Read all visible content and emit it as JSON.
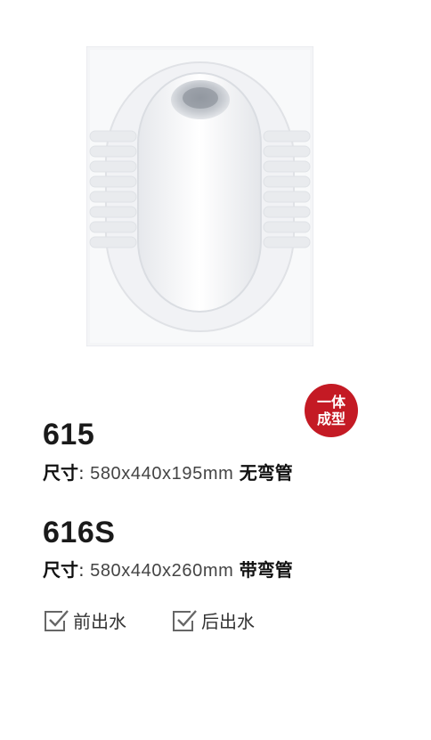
{
  "badge": {
    "line1": "一体",
    "line2": "成型"
  },
  "products": [
    {
      "model": "615",
      "spec_label": "尺寸",
      "spec_colon": ": ",
      "dimensions": "580x440x195mm",
      "pipe": "无弯管"
    },
    {
      "model": "616S",
      "spec_label": "尺寸",
      "spec_colon": ": ",
      "dimensions": "580x440x260mm",
      "pipe": "带弯管"
    }
  ],
  "options": [
    {
      "icon": "checkbox-checked-icon",
      "label": "前出水"
    },
    {
      "icon": "checkbox-checked-icon",
      "label": "后出水"
    }
  ],
  "colors": {
    "badge": "#c41a24",
    "text": "#222222",
    "icon": "#666666"
  }
}
